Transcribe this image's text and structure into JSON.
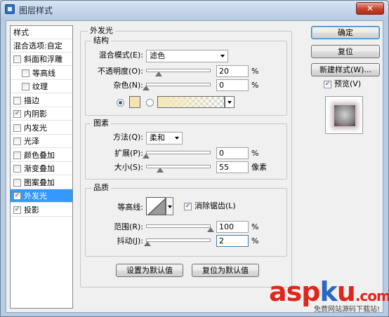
{
  "window": {
    "title": "图层样式",
    "close_glyph": "✕"
  },
  "style_list": {
    "heading": "样式",
    "blending": "混合选项:自定",
    "items": [
      {
        "label": "斜面和浮雕",
        "checked": false,
        "indent": false,
        "selected": false
      },
      {
        "label": "等高线",
        "checked": false,
        "indent": true,
        "selected": false
      },
      {
        "label": "纹理",
        "checked": false,
        "indent": true,
        "selected": false
      },
      {
        "label": "描边",
        "checked": false,
        "indent": false,
        "selected": false
      },
      {
        "label": "内阴影",
        "checked": true,
        "indent": false,
        "selected": false
      },
      {
        "label": "内发光",
        "checked": false,
        "indent": false,
        "selected": false
      },
      {
        "label": "光泽",
        "checked": false,
        "indent": false,
        "selected": false
      },
      {
        "label": "颜色叠加",
        "checked": false,
        "indent": false,
        "selected": false
      },
      {
        "label": "渐变叠加",
        "checked": false,
        "indent": false,
        "selected": false
      },
      {
        "label": "图案叠加",
        "checked": false,
        "indent": false,
        "selected": false
      },
      {
        "label": "外发光",
        "checked": true,
        "indent": false,
        "selected": true
      },
      {
        "label": "投影",
        "checked": true,
        "indent": false,
        "selected": false
      }
    ],
    "check_glyph": "✓"
  },
  "outer_glow": {
    "title": "外发光",
    "structure": {
      "title": "结构",
      "blend_mode_label": "混合模式(E):",
      "blend_mode_value": "滤色",
      "opacity_label": "不透明度(O):",
      "opacity_value": "20",
      "opacity_pct": 20,
      "noise_label": "杂色(N):",
      "noise_value": "0",
      "noise_pct": 0,
      "unit": "%",
      "solid_color": "#f4e4b0",
      "solid_selected": true
    },
    "elements": {
      "title": "图素",
      "technique_label": "方法(Q):",
      "technique_value": "柔和",
      "spread_label": "扩展(P):",
      "spread_value": "0",
      "spread_pct": 0,
      "size_label": "大小(S):",
      "size_value": "55",
      "size_fraction": 0.22,
      "unit": "%",
      "size_unit": "像素"
    },
    "quality": {
      "title": "品质",
      "contour_label": "等高线:",
      "antialias_label": "消除锯齿(L)",
      "antialias_checked": true,
      "range_label": "范围(R):",
      "range_value": "100",
      "range_pct": 100,
      "jitter_label": "抖动(J):",
      "jitter_value": "2",
      "jitter_pct": 2,
      "unit": "%"
    },
    "make_default": "设置为默认值",
    "reset_default": "复位为默认值"
  },
  "side_buttons": {
    "ok": "确定",
    "reset": "复位",
    "new_style": "新建样式(W)...",
    "preview_label": "预览(V)",
    "preview_checked": true
  },
  "watermark": {
    "red1": "asp",
    "blue": "k",
    "red2": "u",
    "suffix": ".com",
    "subtitle": "免费网站源码下载站!"
  }
}
